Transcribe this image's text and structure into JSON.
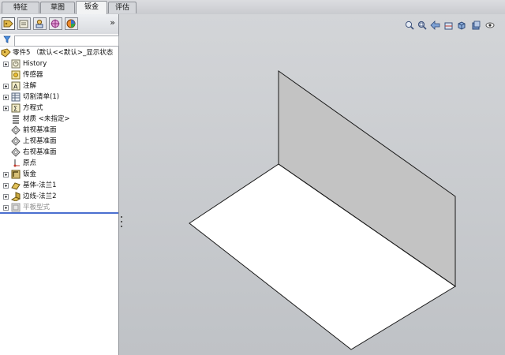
{
  "tabs": [
    {
      "label": "特征",
      "active": false
    },
    {
      "label": "草图",
      "active": false
    },
    {
      "label": "钣金",
      "active": true
    },
    {
      "label": "评估",
      "active": false
    }
  ],
  "panel": {
    "expand_glyph": "»",
    "toolbar_icons": [
      "feature-manager-icon",
      "property-manager-icon",
      "configuration-manager-icon",
      "dimxpert-icon",
      "display-manager-icon"
    ],
    "filter_placeholder": ""
  },
  "tree": {
    "root": {
      "label": "零件5 （默认<<默认>_显示状态",
      "icon": "part-icon"
    },
    "items": [
      {
        "label": "History",
        "icon": "history-icon",
        "expandable": true
      },
      {
        "label": "传感器",
        "icon": "sensor-icon",
        "expandable": false
      },
      {
        "label": "注解",
        "icon": "annotation-icon",
        "expandable": true
      },
      {
        "label": "切割清单(1)",
        "icon": "cut-list-icon",
        "expandable": true
      },
      {
        "label": "方程式",
        "icon": "equation-icon",
        "expandable": true
      },
      {
        "label": "材质 <未指定>",
        "icon": "material-icon",
        "expandable": false
      },
      {
        "label": "前视基准面",
        "icon": "plane-icon",
        "expandable": false
      },
      {
        "label": "上视基准面",
        "icon": "plane-icon",
        "expandable": false
      },
      {
        "label": "右视基准面",
        "icon": "plane-icon",
        "expandable": false
      },
      {
        "label": "原点",
        "icon": "origin-icon",
        "expandable": false
      },
      {
        "label": "钣金",
        "icon": "sheet-metal-icon",
        "expandable": true
      },
      {
        "label": "基体-法兰1",
        "icon": "base-flange-icon",
        "expandable": true
      },
      {
        "label": "边线-法兰2",
        "icon": "edge-flange-icon",
        "expandable": true
      },
      {
        "label": "平板型式",
        "icon": "flat-pattern-icon",
        "expandable": true,
        "suppressed": true
      }
    ]
  },
  "view_toolbar_icons": [
    "zoom-to-fit-icon",
    "zoom-to-area-icon",
    "previous-view-icon",
    "section-view-icon",
    "view-orientation-icon",
    "display-style-icon",
    "hide-show-items-icon"
  ],
  "colors": {
    "viewport_bg": "#c9cbce",
    "flange_face": "#c3c3c3",
    "base_face": "#ffffff",
    "rollback_bar": "#4a6fd0"
  }
}
